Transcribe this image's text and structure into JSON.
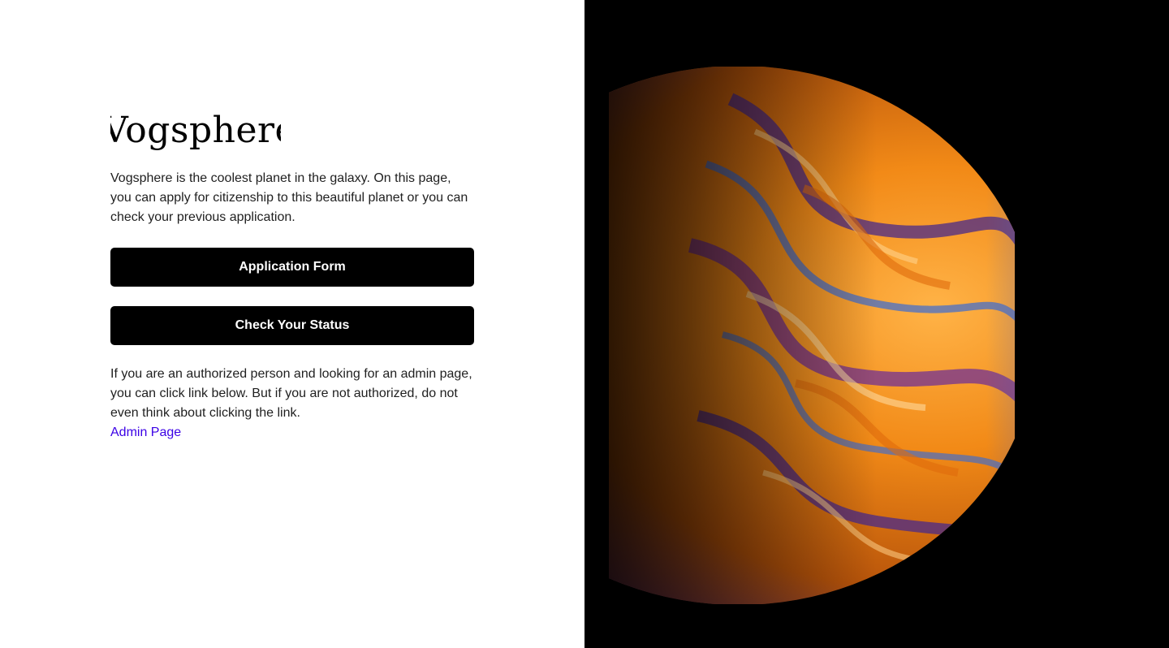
{
  "brand": {
    "name": "Vogsphere"
  },
  "intro": {
    "text": "Vogsphere is the coolest planet in the galaxy. On this page, you can apply for citizenship to this beautiful planet or you can check your previous application."
  },
  "buttons": {
    "application_form": "Application Form",
    "check_status": "Check Your Status"
  },
  "admin": {
    "text": "If you are an authorized person and looking for an admin page, you can click link below. But if you are not authorized, do not even think about clicking the link.",
    "link_label": "Admin Page"
  },
  "hero": {
    "icon": "planet-image",
    "background_color": "#000000",
    "accent_colors": [
      "#f7a51e",
      "#e06a0c",
      "#4a2a8a",
      "#3a6bd1"
    ]
  },
  "colors": {
    "button_bg": "#000000",
    "button_text": "#ffffff",
    "link": "#3b00e6",
    "body_text": "#1f1f1f"
  }
}
